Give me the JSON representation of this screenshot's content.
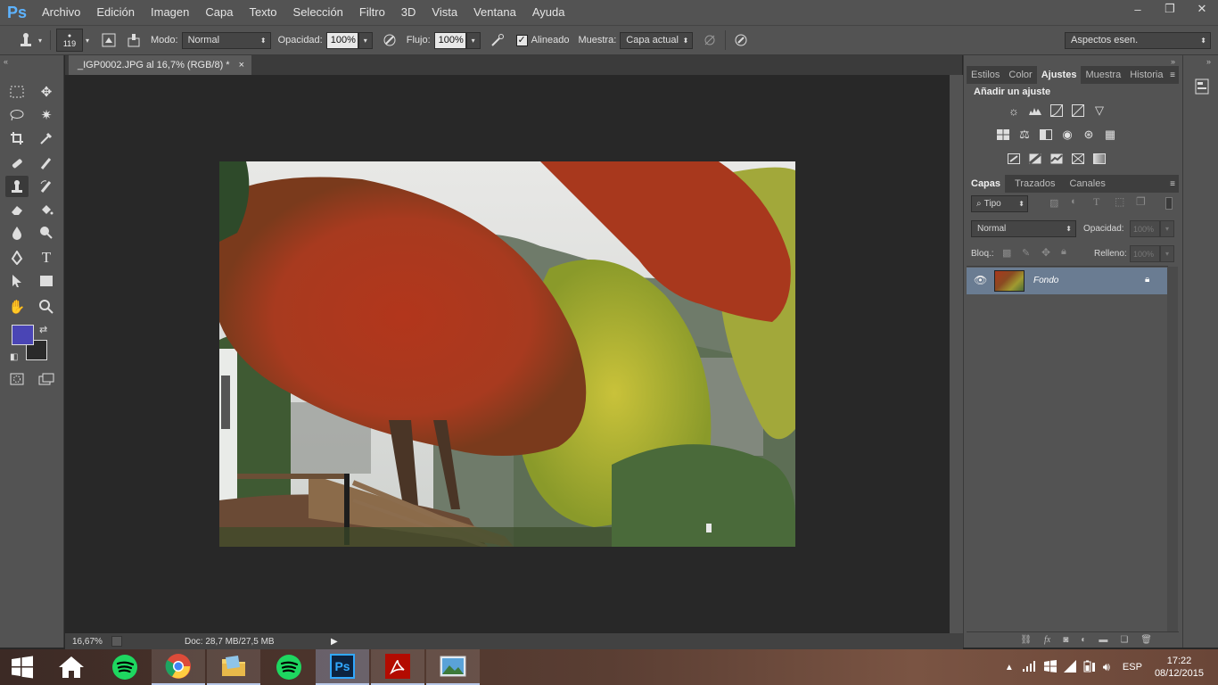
{
  "app": {
    "logo": "Ps",
    "title": "Adobe Photoshop"
  },
  "menu": [
    "Archivo",
    "Edición",
    "Imagen",
    "Capa",
    "Texto",
    "Selección",
    "Filtro",
    "3D",
    "Vista",
    "Ventana",
    "Ayuda"
  ],
  "window_controls": {
    "minimize": "–",
    "restore": "❐",
    "close": "✕"
  },
  "options": {
    "brush_size": "119",
    "modo_label": "Modo:",
    "modo_value": "Normal",
    "opacidad_label": "Opacidad:",
    "opacidad_value": "100%",
    "flujo_label": "Flujo:",
    "flujo_value": "100%",
    "alineado_label": "Alineado",
    "alineado_checked": true,
    "muestra_label": "Muestra:",
    "muestra_value": "Capa actual",
    "workspace": "Aspectos esen."
  },
  "document": {
    "tab_title": "_IGP0002.JPG al 16,7% (RGB/8) *",
    "close": "×",
    "zoom": "16,67%",
    "doc_info": "Doc: 28,7 MB/27,5 MB"
  },
  "tools": {
    "foreground_color": "#4a45b5",
    "background_color": "#2a2a2a"
  },
  "adjustments_panel": {
    "tabs": [
      "Estilos",
      "Color",
      "Ajustes",
      "Muestra",
      "Historia"
    ],
    "active_tab": "Ajustes",
    "heading": "Añadir un ajuste",
    "icons": [
      [
        "brightness-contrast-icon",
        "levels-icon",
        "curves-icon",
        "exposure-icon",
        "vibrance-icon"
      ],
      [
        "hue-saturation-icon",
        "color-balance-icon",
        "black-white-icon",
        "photo-filter-icon",
        "channel-mixer-icon",
        "color-lookup-icon"
      ],
      [
        "invert-icon",
        "posterize-icon",
        "threshold-icon",
        "selective-color-icon",
        "gradient-map-icon"
      ]
    ]
  },
  "layers_panel": {
    "tabs": [
      "Capas",
      "Trazados",
      "Canales"
    ],
    "active_tab": "Capas",
    "filter": "Tipo",
    "blend_mode": "Normal",
    "opacity_label": "Opacidad:",
    "opacity_value": "100%",
    "lock_label": "Bloq.:",
    "fill_label": "Relleno:",
    "fill_value": "100%",
    "layers": [
      {
        "name": "Fondo",
        "visible": true,
        "locked": true
      }
    ]
  },
  "taskbar": {
    "apps": [
      "start",
      "home",
      "spotify",
      "chrome",
      "explorer",
      "spotify",
      "photoshop",
      "acrobat",
      "photos"
    ],
    "open_app": "photoshop",
    "language": "ESP",
    "time": "17:22",
    "date": "08/12/2015"
  }
}
